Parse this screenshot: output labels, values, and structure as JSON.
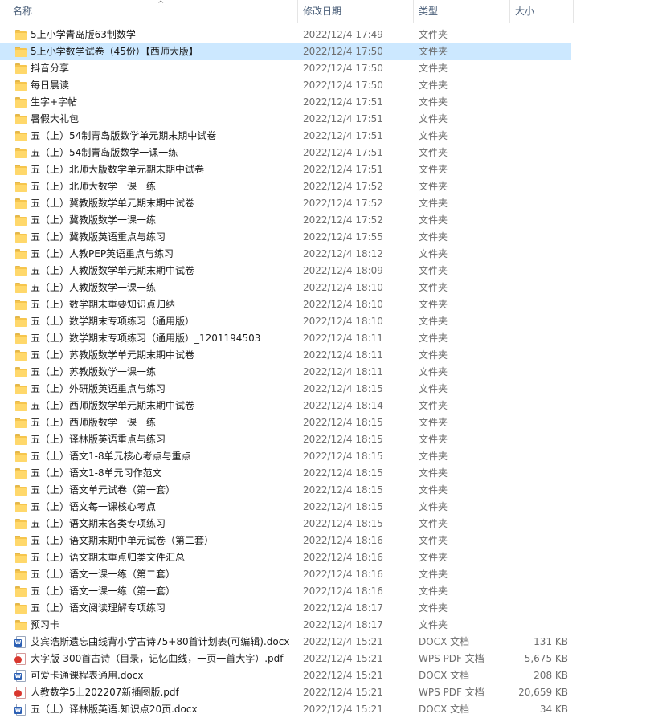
{
  "columns": {
    "name": "名称",
    "modified": "修改日期",
    "type": "类型",
    "size": "大小"
  },
  "files": [
    {
      "name": "5上小学青岛版63制数学",
      "modified": "2022/12/4 17:49",
      "type": "文件夹",
      "size": "",
      "icon": "folder-icon"
    },
    {
      "name": "5上小学数学试卷（45份）【西师大版】",
      "modified": "2022/12/4 17:50",
      "type": "文件夹",
      "size": "",
      "icon": "folder-icon"
    },
    {
      "name": "抖音分享",
      "modified": "2022/12/4 17:50",
      "type": "文件夹",
      "size": "",
      "icon": "folder-icon"
    },
    {
      "name": "每日晨读",
      "modified": "2022/12/4 17:50",
      "type": "文件夹",
      "size": "",
      "icon": "folder-icon"
    },
    {
      "name": "生字+字帖",
      "modified": "2022/12/4 17:51",
      "type": "文件夹",
      "size": "",
      "icon": "folder-icon"
    },
    {
      "name": "暑假大礼包",
      "modified": "2022/12/4 17:51",
      "type": "文件夹",
      "size": "",
      "icon": "folder-icon"
    },
    {
      "name": "五（上）54制青岛版数学单元期末期中试卷",
      "modified": "2022/12/4 17:51",
      "type": "文件夹",
      "size": "",
      "icon": "folder-icon"
    },
    {
      "name": "五（上）54制青岛版数学一课一练",
      "modified": "2022/12/4 17:51",
      "type": "文件夹",
      "size": "",
      "icon": "folder-icon"
    },
    {
      "name": "五（上）北师大版数学单元期末期中试卷",
      "modified": "2022/12/4 17:51",
      "type": "文件夹",
      "size": "",
      "icon": "folder-icon"
    },
    {
      "name": "五（上）北师大数学一课一练",
      "modified": "2022/12/4 17:52",
      "type": "文件夹",
      "size": "",
      "icon": "folder-icon"
    },
    {
      "name": "五（上）冀教版数学单元期末期中试卷",
      "modified": "2022/12/4 17:52",
      "type": "文件夹",
      "size": "",
      "icon": "folder-icon"
    },
    {
      "name": "五（上）冀教版数学一课一练",
      "modified": "2022/12/4 17:52",
      "type": "文件夹",
      "size": "",
      "icon": "folder-icon"
    },
    {
      "name": "五（上）冀教版英语重点与练习",
      "modified": "2022/12/4 17:55",
      "type": "文件夹",
      "size": "",
      "icon": "folder-icon"
    },
    {
      "name": "五（上）人教PEP英语重点与练习",
      "modified": "2022/12/4 18:12",
      "type": "文件夹",
      "size": "",
      "icon": "folder-icon"
    },
    {
      "name": "五（上）人教版数学单元期末期中试卷",
      "modified": "2022/12/4 18:09",
      "type": "文件夹",
      "size": "",
      "icon": "folder-icon"
    },
    {
      "name": "五（上）人教版数学一课一练",
      "modified": "2022/12/4 18:10",
      "type": "文件夹",
      "size": "",
      "icon": "folder-icon"
    },
    {
      "name": "五（上）数学期末重要知识点归纳",
      "modified": "2022/12/4 18:10",
      "type": "文件夹",
      "size": "",
      "icon": "folder-icon"
    },
    {
      "name": "五（上）数学期末专项练习（通用版）",
      "modified": "2022/12/4 18:10",
      "type": "文件夹",
      "size": "",
      "icon": "folder-icon"
    },
    {
      "name": "五（上）数学期末专项练习（通用版）_1201194503",
      "modified": "2022/12/4 18:11",
      "type": "文件夹",
      "size": "",
      "icon": "folder-icon"
    },
    {
      "name": "五（上）苏教版数学单元期末期中试卷",
      "modified": "2022/12/4 18:11",
      "type": "文件夹",
      "size": "",
      "icon": "folder-icon"
    },
    {
      "name": "五（上）苏教版数学一课一练",
      "modified": "2022/12/4 18:11",
      "type": "文件夹",
      "size": "",
      "icon": "folder-icon"
    },
    {
      "name": "五（上）外研版英语重点与练习",
      "modified": "2022/12/4 18:15",
      "type": "文件夹",
      "size": "",
      "icon": "folder-icon"
    },
    {
      "name": "五（上）西师版数学单元期末期中试卷",
      "modified": "2022/12/4 18:14",
      "type": "文件夹",
      "size": "",
      "icon": "folder-icon"
    },
    {
      "name": "五（上）西师版数学一课一练",
      "modified": "2022/12/4 18:15",
      "type": "文件夹",
      "size": "",
      "icon": "folder-icon"
    },
    {
      "name": "五（上）译林版英语重点与练习",
      "modified": "2022/12/4 18:15",
      "type": "文件夹",
      "size": "",
      "icon": "folder-icon"
    },
    {
      "name": "五（上）语文1-8单元核心考点与重点",
      "modified": "2022/12/4 18:15",
      "type": "文件夹",
      "size": "",
      "icon": "folder-icon"
    },
    {
      "name": "五（上）语文1-8单元习作范文",
      "modified": "2022/12/4 18:15",
      "type": "文件夹",
      "size": "",
      "icon": "folder-icon"
    },
    {
      "name": "五（上）语文单元试卷（第一套）",
      "modified": "2022/12/4 18:15",
      "type": "文件夹",
      "size": "",
      "icon": "folder-icon"
    },
    {
      "name": "五（上）语文每一课核心考点",
      "modified": "2022/12/4 18:15",
      "type": "文件夹",
      "size": "",
      "icon": "folder-icon"
    },
    {
      "name": "五（上）语文期末各类专项练习",
      "modified": "2022/12/4 18:15",
      "type": "文件夹",
      "size": "",
      "icon": "folder-icon"
    },
    {
      "name": "五（上）语文期末期中单元试卷（第二套）",
      "modified": "2022/12/4 18:16",
      "type": "文件夹",
      "size": "",
      "icon": "folder-icon"
    },
    {
      "name": "五（上）语文期末重点归类文件汇总",
      "modified": "2022/12/4 18:16",
      "type": "文件夹",
      "size": "",
      "icon": "folder-icon"
    },
    {
      "name": "五（上）语文一课一练（第二套）",
      "modified": "2022/12/4 18:16",
      "type": "文件夹",
      "size": "",
      "icon": "folder-icon"
    },
    {
      "name": "五（上）语文一课一练（第一套）",
      "modified": "2022/12/4 18:16",
      "type": "文件夹",
      "size": "",
      "icon": "folder-icon"
    },
    {
      "name": "五（上）语文阅读理解专项练习",
      "modified": "2022/12/4 18:17",
      "type": "文件夹",
      "size": "",
      "icon": "folder-icon"
    },
    {
      "name": "预习卡",
      "modified": "2022/12/4 18:17",
      "type": "文件夹",
      "size": "",
      "icon": "folder-icon"
    },
    {
      "name": "艾宾浩斯遗忘曲线背小学古诗75+80首计划表(可编辑).docx",
      "modified": "2022/12/4 15:21",
      "type": "DOCX 文档",
      "size": "131 KB",
      "icon": "docx-icon"
    },
    {
      "name": "大字版-300首古诗（目录，记忆曲线，一页一首大字）.pdf",
      "modified": "2022/12/4 15:21",
      "type": "WPS PDF 文档",
      "size": "5,675 KB",
      "icon": "pdf-icon"
    },
    {
      "name": "可爱卡通课程表通用.docx",
      "modified": "2022/12/4 15:21",
      "type": "DOCX 文档",
      "size": "208 KB",
      "icon": "docx-icon"
    },
    {
      "name": "人教数学5上202207新插图版.pdf",
      "modified": "2022/12/4 15:21",
      "type": "WPS PDF 文档",
      "size": "20,659 KB",
      "icon": "pdf-icon"
    },
    {
      "name": "五（上）译林版英语.知识点20页.docx",
      "modified": "2022/12/4 15:21",
      "type": "DOCX 文档",
      "size": "34 KB",
      "icon": "docx-icon"
    }
  ],
  "selected_index": 1
}
